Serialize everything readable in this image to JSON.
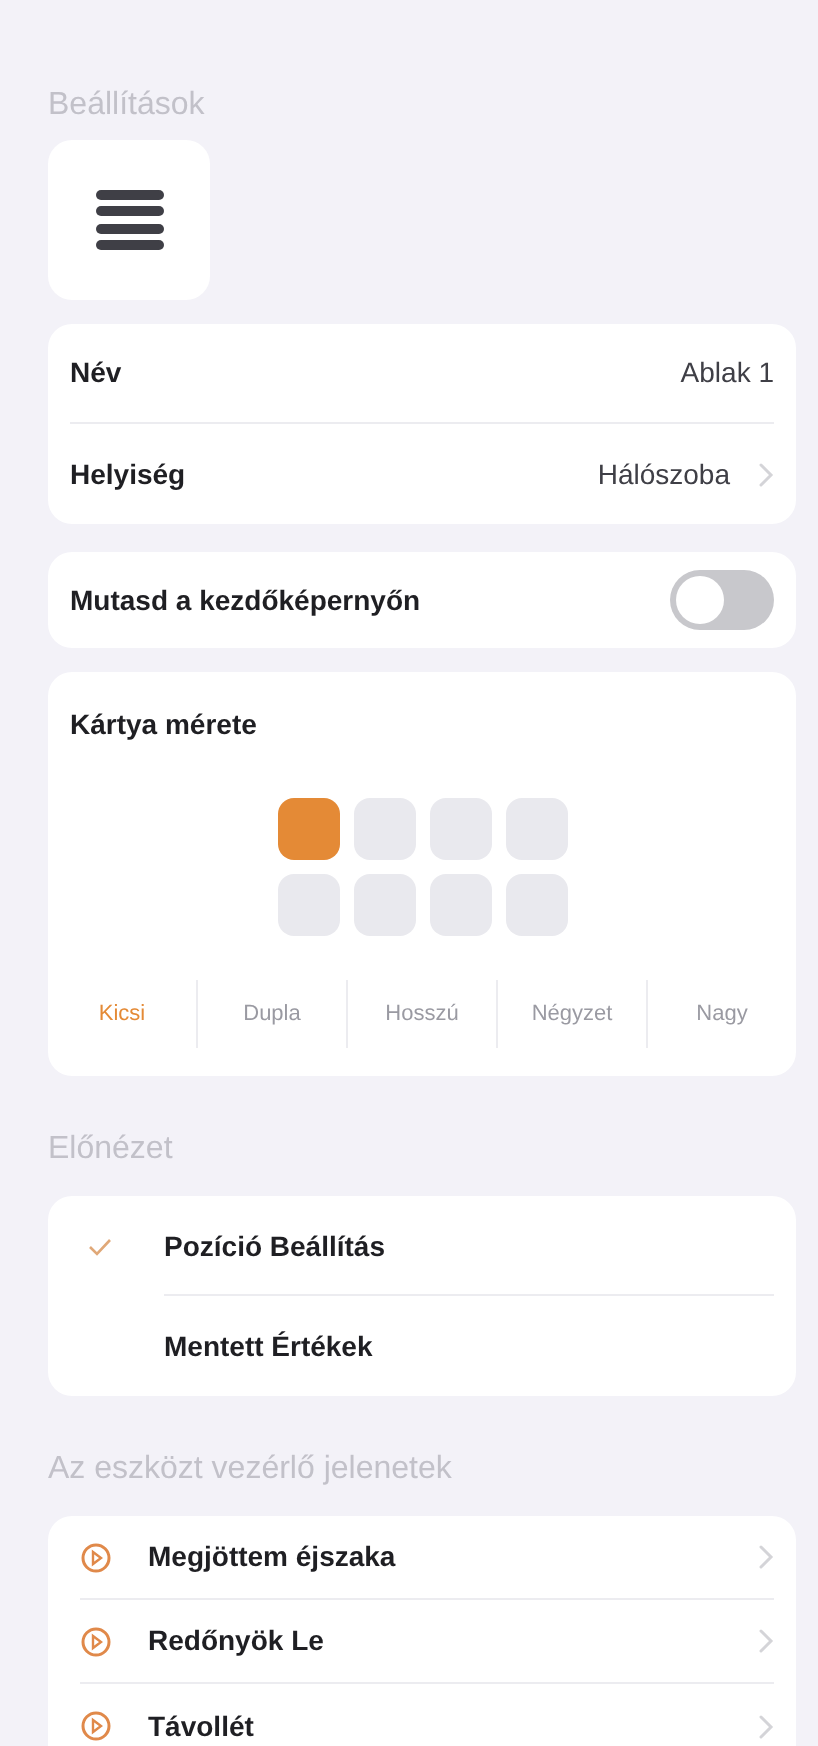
{
  "header": {
    "title": "Beállítások"
  },
  "info_rows": [
    {
      "label": "Név",
      "value": "Ablak 1",
      "chevron": false
    },
    {
      "label": "Helyiség",
      "value": "Hálószoba",
      "chevron": true
    }
  ],
  "home_toggle": {
    "label": "Mutasd a kezdőképernyőn",
    "on": false
  },
  "card_size": {
    "title": "Kártya mérete",
    "grid_cells": [
      {
        "selected": true
      },
      {
        "selected": false
      },
      {
        "selected": false
      },
      {
        "selected": false
      },
      {
        "selected": false
      },
      {
        "selected": false
      },
      {
        "selected": false
      },
      {
        "selected": false
      }
    ],
    "options": [
      {
        "label": "Kicsi",
        "selected": true
      },
      {
        "label": "Dupla",
        "selected": false
      },
      {
        "label": "Hosszú",
        "selected": false
      },
      {
        "label": "Négyzet",
        "selected": false
      },
      {
        "label": "Nagy",
        "selected": false
      }
    ]
  },
  "preview": {
    "title": "Előnézet",
    "items": [
      {
        "label": "Pozíció Beállítás",
        "selected": true
      },
      {
        "label": "Mentett Értékek",
        "selected": false
      }
    ]
  },
  "scenes": {
    "title": "Az eszközt vezérlő jelenetek",
    "items": [
      {
        "label": "Megjöttem éjszaka"
      },
      {
        "label": "Redőnyök Le"
      },
      {
        "label": "Távollét"
      }
    ]
  }
}
